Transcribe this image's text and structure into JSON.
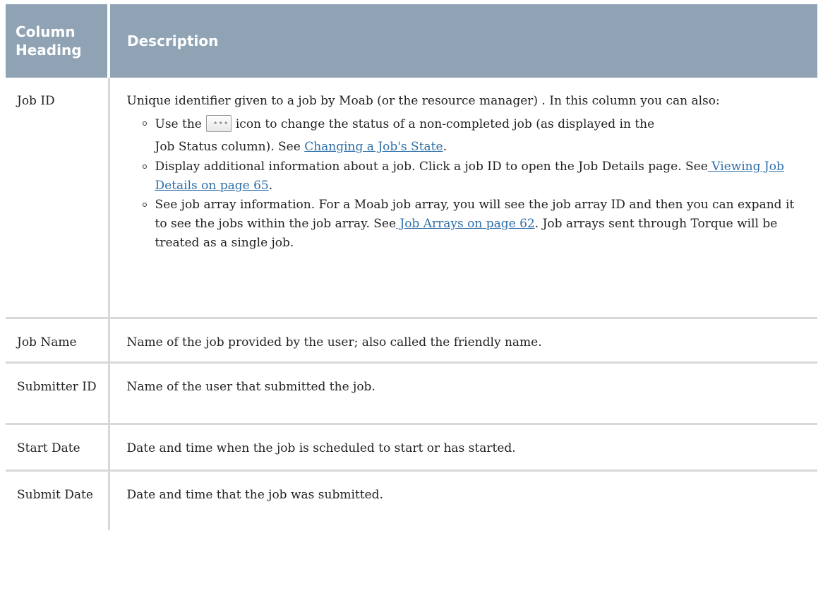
{
  "table": {
    "headers": [
      "Column Heading",
      "Description"
    ],
    "rows": [
      {
        "heading": "Job ID",
        "intro": "Unique identifier given to a job by Moab (or the resource manager) . In this column you can also:",
        "bullets": [
          {
            "before_icon": "Use the",
            "icon": "more-options-icon",
            "icon_glyph": "•••",
            "after_icon_line1": "icon to change the status of a non-completed job (as displayed in the",
            "after_icon_line2": "Job Status column). See",
            "link": "Changing a Job's State",
            "after_link": "."
          },
          {
            "text": "Display additional information about a job. Click a job ID to open the Job Details page. See",
            "link": " Viewing Job Details on page 65",
            "after_link": "."
          },
          {
            "text": "See job array information. For a Moab job array, you will see the job array ID and then you can expand it to see the jobs within the job array. See",
            "link": " Job Arrays on page 62",
            "after_link": ". Job arrays sent through Torque will be treated as a single job."
          }
        ]
      },
      {
        "heading": "Job Name",
        "description": "Name of the job provided by the user; also called the friendly name."
      },
      {
        "heading": "Submitter ID",
        "description": "Name of the user that submitted the job."
      },
      {
        "heading": "Start Date",
        "description": "Date and time when the job is scheduled to start or has started."
      },
      {
        "heading": "Submit Date",
        "description": "Date and time that the job was submitted."
      }
    ]
  },
  "colors": {
    "header_bg": "#8fa3b5",
    "header_text": "#ffffff",
    "link": "#2f6fa8",
    "rule": "#d8d8d8"
  }
}
